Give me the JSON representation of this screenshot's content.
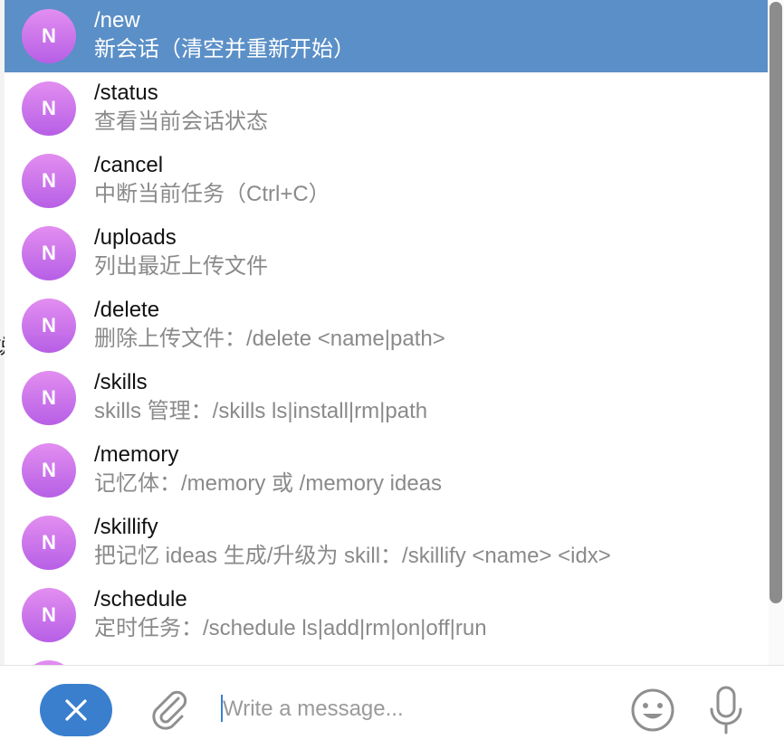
{
  "background_glyph": "说",
  "command_suggestions": [
    {
      "avatar": "N",
      "name": "/new",
      "description": "新会话（清空并重新开始）",
      "selected": true
    },
    {
      "avatar": "N",
      "name": "/status",
      "description": "查看当前会话状态",
      "selected": false
    },
    {
      "avatar": "N",
      "name": "/cancel",
      "description": "中断当前任务（Ctrl+C）",
      "selected": false
    },
    {
      "avatar": "N",
      "name": "/uploads",
      "description": "列出最近上传文件",
      "selected": false
    },
    {
      "avatar": "N",
      "name": "/delete",
      "description": "删除上传文件：/delete <name|path>",
      "selected": false
    },
    {
      "avatar": "N",
      "name": "/skills",
      "description": "skills 管理：/skills ls|install|rm|path",
      "selected": false
    },
    {
      "avatar": "N",
      "name": "/memory",
      "description": "记忆体：/memory 或 /memory ideas",
      "selected": false
    },
    {
      "avatar": "N",
      "name": "/skillify",
      "description": "把记忆 ideas 生成/升级为 skill：/skillify <name> <idx>",
      "selected": false
    },
    {
      "avatar": "N",
      "name": "/schedule",
      "description": "定时任务：/schedule ls|add|rm|on|off|run",
      "selected": false
    },
    {
      "avatar": "N",
      "name": "",
      "description": "",
      "selected": false
    }
  ],
  "composer": {
    "placeholder": "Write a message...",
    "value": "",
    "cancel_icon": "close-icon",
    "attach_icon": "paperclip-icon",
    "emoji_icon": "smiley-icon",
    "voice_icon": "microphone-icon"
  },
  "colors": {
    "selected_row": "#5b8fc7",
    "avatar_top": "#e28ef0",
    "avatar_bottom": "#b75fe6",
    "accent": "#3a7fce",
    "description_text": "#8a8a8a",
    "scroll_thumb": "#8c8c8c"
  }
}
